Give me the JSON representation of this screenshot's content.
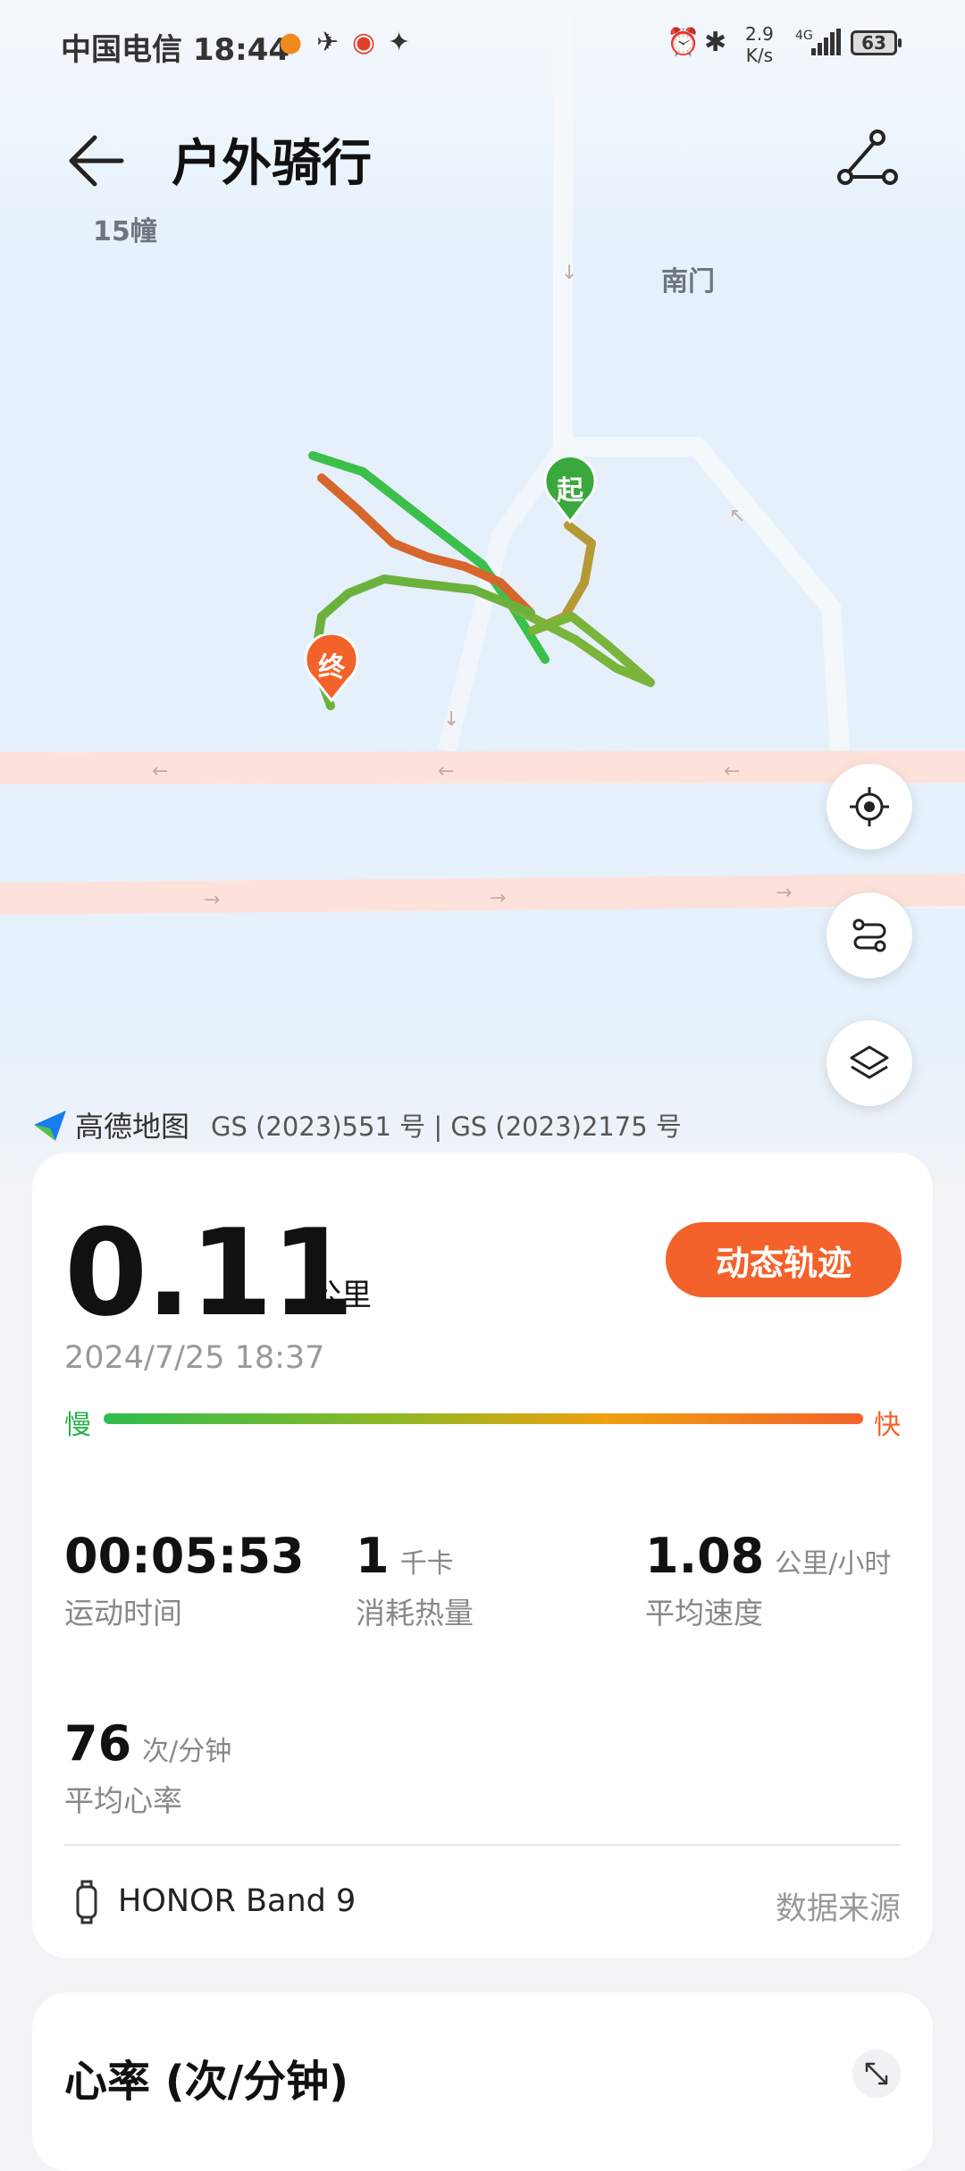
{
  "status_bar": {
    "carrier_time": "中国电信 18:44",
    "net_speed_value": "2.9",
    "net_speed_unit": "K/s",
    "signal": "4G",
    "battery": "63"
  },
  "header": {
    "title": "户外骑行"
  },
  "map": {
    "labels": {
      "building": "15幢",
      "gate": "南门"
    },
    "start_marker": "起",
    "end_marker": "终",
    "credit_brand": "高德地图",
    "credit_license": "GS (2023)551 号 | GS (2023)2175 号",
    "colors": {
      "slow": "#2ebd4e",
      "medium": "#a8a830",
      "fast": "#f2622a",
      "road": "#fde2dc"
    }
  },
  "summary": {
    "distance": "0.11",
    "distance_unit": "公里",
    "play_button": "动态轨迹",
    "datetime": "2024/7/25 18:37",
    "speed_slow_label": "慢",
    "speed_fast_label": "快",
    "stats": [
      {
        "value": "00:05:53",
        "unit": "",
        "label": "运动时间"
      },
      {
        "value": "1",
        "unit": "千卡",
        "label": "消耗热量"
      },
      {
        "value": "1.08",
        "unit": "公里/小时",
        "label": "平均速度"
      },
      {
        "value": "76",
        "unit": "次/分钟",
        "label": "平均心率"
      }
    ],
    "device": "HONOR Band 9",
    "data_source": "数据来源"
  },
  "heart_rate": {
    "title": "心率 (次/分钟)"
  }
}
